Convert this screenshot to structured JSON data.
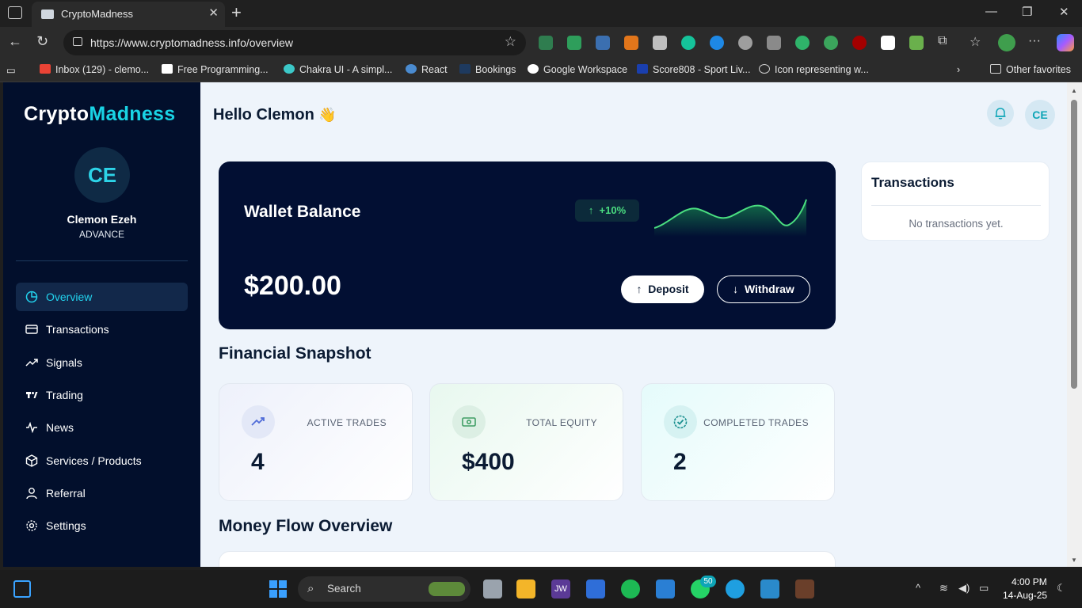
{
  "browser": {
    "tab_title": "CryptoMadness",
    "url": "https://www.cryptomadness.info/overview",
    "bookmarks": [
      {
        "label": "Inbox (129) - clemo..."
      },
      {
        "label": "Free Programming..."
      },
      {
        "label": "Chakra UI - A simpl..."
      },
      {
        "label": "React"
      },
      {
        "label": "Bookings"
      },
      {
        "label": "Google Workspace"
      },
      {
        "label": "Score808 - Sport Liv..."
      },
      {
        "label": "Icon representing w..."
      }
    ],
    "other_favorites": "Other favorites"
  },
  "sidebar": {
    "logo_part1": "Crypto",
    "logo_part2": "Madness",
    "avatar_initials": "CE",
    "user_name": "Clemon Ezeh",
    "user_level": "ADVANCE",
    "items": [
      {
        "label": "Overview",
        "icon": "clock-pie-icon",
        "active": true
      },
      {
        "label": "Transactions",
        "icon": "card-icon"
      },
      {
        "label": "Signals",
        "icon": "trend-icon"
      },
      {
        "label": "Trading",
        "icon": "tradingview-icon"
      },
      {
        "label": "News",
        "icon": "pulse-icon"
      },
      {
        "label": "Services / Products",
        "icon": "box-icon"
      },
      {
        "label": "Referral",
        "icon": "user-icon"
      },
      {
        "label": "Settings",
        "icon": "gear-icon"
      }
    ]
  },
  "header": {
    "greeting": "Hello Clemon",
    "greeting_emoji": "👋",
    "avatar_initials": "CE"
  },
  "wallet": {
    "title": "Wallet Balance",
    "change": "+10%",
    "amount": "$200.00",
    "deposit_label": "Deposit",
    "withdraw_label": "Withdraw"
  },
  "snapshot": {
    "title": "Financial Snapshot",
    "cards": [
      {
        "label": "ACTIVE TRADES",
        "value": "4",
        "icon": "trend-up-icon"
      },
      {
        "label": "TOTAL EQUITY",
        "value": "$400",
        "icon": "cash-icon"
      },
      {
        "label": "COMPLETED TRADES",
        "value": "2",
        "icon": "check-badge-icon"
      }
    ]
  },
  "money_flow": {
    "title": "Money Flow Overview"
  },
  "transactions_panel": {
    "title": "Transactions",
    "empty_text": "No transactions yet."
  },
  "taskbar": {
    "search_label": "Search",
    "badge_count": "50",
    "time": "4:00 PM",
    "date": "14-Aug-25"
  },
  "colors": {
    "accent": "#19d3e4",
    "sidebar_bg": "#020f2c",
    "wallet_bg": "#020f33",
    "positive": "#4ade80"
  }
}
